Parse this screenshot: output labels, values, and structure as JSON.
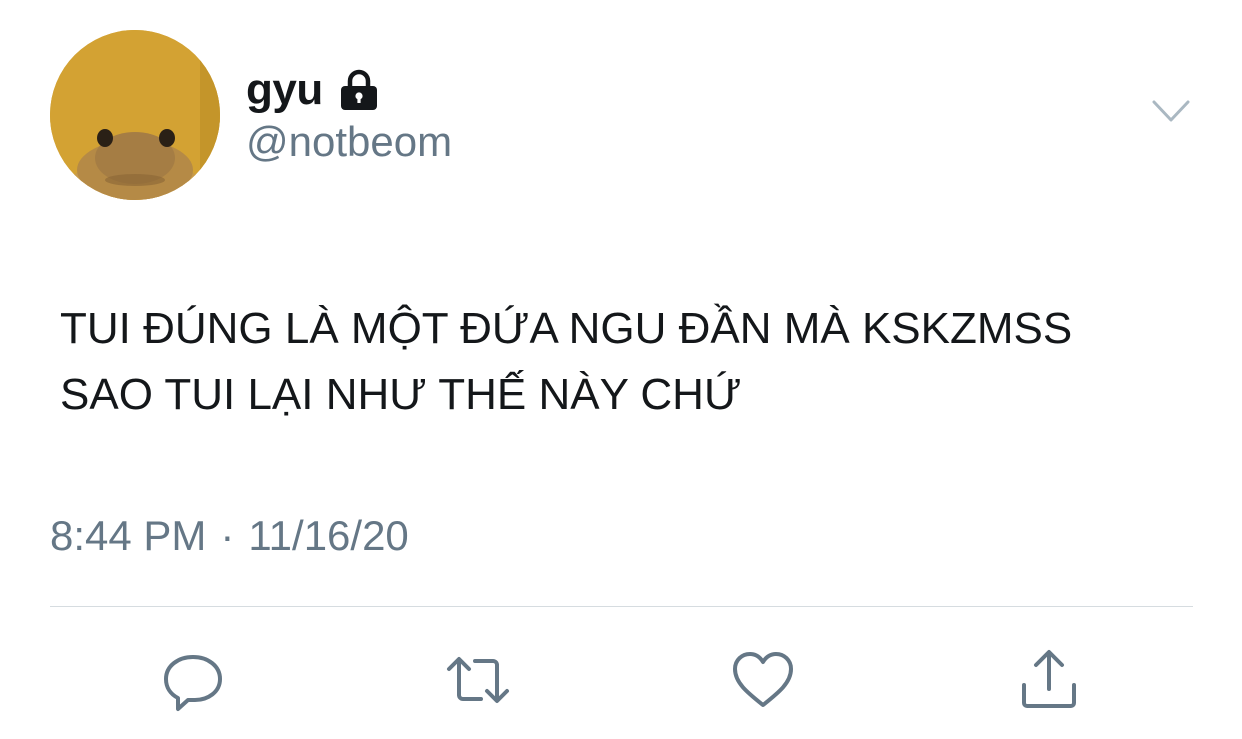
{
  "tweet": {
    "author": {
      "display_name": "gyu",
      "handle": "@notbeom",
      "protected_icon": "lock-icon",
      "avatar_icon": "lizard-avatar"
    },
    "text": "TUI ĐÚNG LÀ MỘT ĐỨA NGU ĐẦN MÀ KSKZMSS\nSAO TUI LẠI NHƯ THẾ NÀY CHỨ",
    "time": "8:44 PM",
    "separator": "·",
    "date": "11/16/20",
    "menu_icon": "chevron-down-icon"
  },
  "actions": [
    {
      "name": "reply",
      "icon": "reply-icon"
    },
    {
      "name": "retweet",
      "icon": "retweet-icon"
    },
    {
      "name": "like",
      "icon": "heart-icon"
    },
    {
      "name": "share",
      "icon": "share-icon"
    }
  ],
  "colors": {
    "text_primary": "#14171a",
    "text_secondary": "#657786",
    "divider": "#d6dce0",
    "action_icon": "#657786"
  }
}
